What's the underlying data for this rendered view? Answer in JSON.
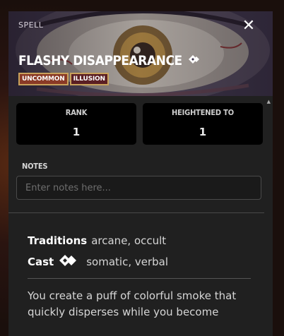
{
  "header": {
    "type_label": "SPELL",
    "title": "FLASHY DISAPPEARANCE",
    "close_icon": "close-icon",
    "action_icon": "two-action-icon",
    "traits": [
      "UNCOMMON",
      "ILLUSION"
    ]
  },
  "stats": {
    "rank_label": "RANK",
    "rank_value": "1",
    "heightened_label": "HEIGHTENED TO",
    "heightened_value": "1"
  },
  "notes": {
    "label": "NOTES",
    "placeholder": "Enter notes here..."
  },
  "details": {
    "traditions_label": "Traditions",
    "traditions_value": "arcane, occult",
    "cast_label": "Cast",
    "cast_icon": "two-action-icon",
    "cast_value": "somatic, verbal",
    "description": "You create a puff of colorful smoke that quickly disperses while you become"
  },
  "colors": {
    "panel_bg": "#202020",
    "trait_border": "#c9a25c",
    "trait_uncommon": "#8a3a26",
    "trait_illusion": "#5b1f23"
  }
}
